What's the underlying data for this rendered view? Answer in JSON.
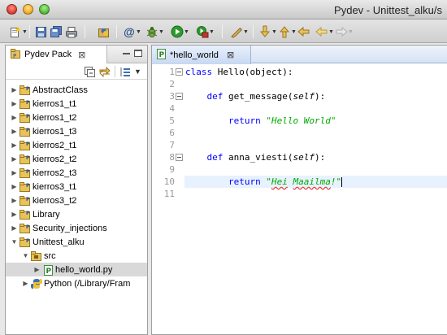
{
  "window": {
    "title": "Pydev - Unittest_alku/s"
  },
  "colors": {
    "keyword": "#0000ff",
    "string": "#00aa00",
    "selection": "#d9d9d9",
    "current_line": "#e8f2fe",
    "tab_active": "#c8d8f2"
  },
  "toolbar": {
    "icons": [
      "new-icon",
      "save-icon",
      "save-all-icon",
      "print-icon",
      "pydev-perspective-icon",
      "at-icon",
      "debug-icon",
      "run-icon",
      "external-tools-icon",
      "marker-icon",
      "next-annotation-icon",
      "previous-annotation-icon",
      "last-edit-icon",
      "back-icon",
      "forward-icon"
    ]
  },
  "left_panel": {
    "tab_label": "Pydev Pack",
    "tab_close": "⊠",
    "tree": [
      {
        "label": "AbstractClass",
        "expanded": false,
        "depth": 0,
        "type": "project"
      },
      {
        "label": "kierros1_t1",
        "expanded": false,
        "depth": 0,
        "type": "project"
      },
      {
        "label": "kierros1_t2",
        "expanded": false,
        "depth": 0,
        "type": "project"
      },
      {
        "label": "kierros1_t3",
        "expanded": false,
        "depth": 0,
        "type": "project"
      },
      {
        "label": "kierros2_t1",
        "expanded": false,
        "depth": 0,
        "type": "project"
      },
      {
        "label": "kierros2_t2",
        "expanded": false,
        "depth": 0,
        "type": "project"
      },
      {
        "label": "kierros2_t3",
        "expanded": false,
        "depth": 0,
        "type": "project"
      },
      {
        "label": "kierros3_t1",
        "expanded": false,
        "depth": 0,
        "type": "project"
      },
      {
        "label": "kierros3_t2",
        "expanded": false,
        "depth": 0,
        "type": "project"
      },
      {
        "label": "Library",
        "expanded": false,
        "depth": 0,
        "type": "project"
      },
      {
        "label": "Security_injections",
        "expanded": false,
        "depth": 0,
        "type": "project"
      },
      {
        "label": "Unittest_alku",
        "expanded": true,
        "depth": 0,
        "type": "project"
      },
      {
        "label": "src",
        "expanded": true,
        "depth": 1,
        "type": "source-folder"
      },
      {
        "label": "hello_world.py",
        "expanded": false,
        "depth": 2,
        "type": "python-file",
        "selected": true
      },
      {
        "label": "Python  (/Library/Fram",
        "expanded": false,
        "depth": 1,
        "type": "interpreter"
      }
    ]
  },
  "editor": {
    "tab_label": "*hello_world",
    "tab_close": "⊠",
    "line_numbers": [
      "1",
      "2",
      "3",
      "4",
      "5",
      "6",
      "7",
      "8",
      "9",
      "10",
      "11"
    ],
    "lines": {
      "l1_kw": "class",
      "l1_rest": " Hello(object):",
      "l3_kw": "def",
      "l3_name": " get_message(",
      "l3_self": "self",
      "l3_end": "):",
      "l5_kw": "return",
      "l5_str": "\"Hello World\"",
      "l8_kw": "def",
      "l8_name": " anna_viesti(",
      "l8_self": "self",
      "l8_end": "):",
      "l10_kw": "return",
      "l10_q1": "\"",
      "l10_w1": "Hei",
      "l10_sp": " ",
      "l10_w2": "Maailma",
      "l10_q2": "!\""
    }
  }
}
